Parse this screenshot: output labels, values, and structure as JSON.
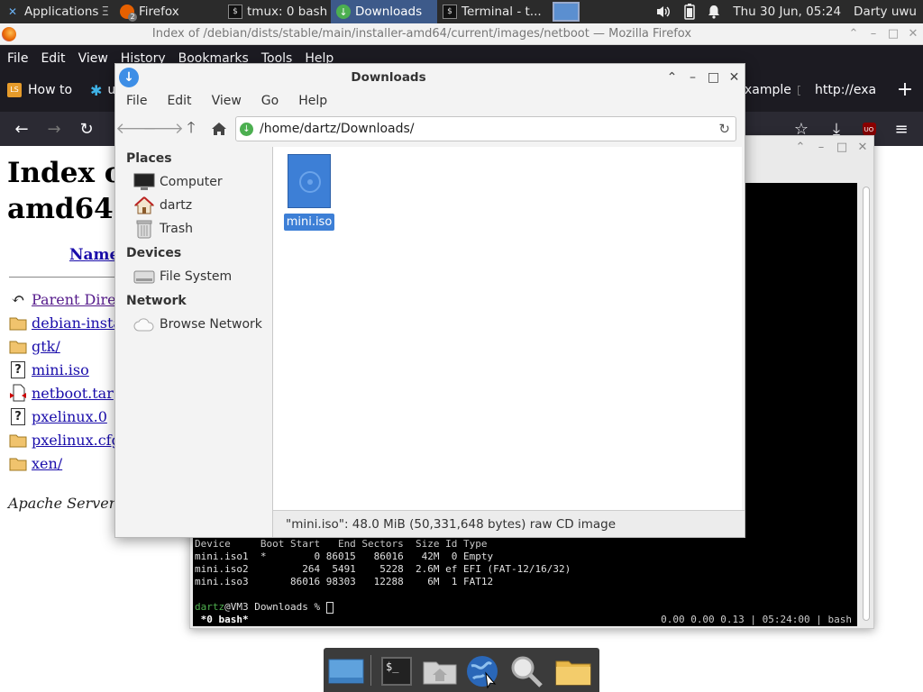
{
  "top_panel": {
    "applications_label": "Applications",
    "items": [
      {
        "label": "Firefox",
        "badge": "2"
      },
      {
        "label": "tmux: 0 bash"
      },
      {
        "label": "Downloads"
      },
      {
        "label": "Terminal - t..."
      }
    ],
    "clock": "Thu 30 Jun, 05:24",
    "user": "Darty uwu",
    "icons": [
      "xfce-icon",
      "firefox-icon",
      "terminal-icon",
      "download-icon",
      "workspace-icon",
      "volume-icon",
      "battery-icon",
      "notification-bell-icon"
    ]
  },
  "firefox": {
    "window_title": "Index of /debian/dists/stable/main/installer-amd64/current/images/netboot — Mozilla Firefox",
    "menu": [
      "File",
      "Edit",
      "View",
      "History",
      "Bookmarks",
      "Tools",
      "Help"
    ],
    "tabs": [
      {
        "label": "How to"
      },
      {
        "label": "u"
      },
      {
        "label": "xample"
      },
      {
        "label": "http://exa"
      }
    ],
    "page": {
      "heading_line1": "Index o",
      "heading_line2": "amd64",
      "name_column": "Name",
      "entries": [
        "Parent Dire",
        "debian-insta",
        "gtk/",
        "mini.iso",
        "netboot.tar",
        "pxelinux.0",
        "pxelinux.cfg",
        "xen/"
      ],
      "footer": "Apache Server"
    }
  },
  "file_manager": {
    "title": "Downloads",
    "menu": [
      "File",
      "Edit",
      "View",
      "Go",
      "Help"
    ],
    "location": "/home/dartz/Downloads/",
    "sidebar": {
      "places_heading": "Places",
      "places": [
        "Computer",
        "dartz",
        "Trash"
      ],
      "devices_heading": "Devices",
      "devices": [
        "File System"
      ],
      "network_heading": "Network",
      "network": [
        "Browse Network"
      ]
    },
    "files": [
      {
        "name": "mini.iso",
        "selected": true
      }
    ],
    "status": "\"mini.iso\": 48.0 MiB (50,331,648 bytes) raw CD image"
  },
  "terminal": {
    "header": "Device     Boot Start   End Sectors  Size Id Type",
    "rows": [
      "mini.iso1  *        0 86015   86016   42M  0 Empty",
      "mini.iso2         264  5491    5228  2.6M ef EFI (FAT-12/16/32)",
      "mini.iso3       86016 98303   12288    6M  1 FAT12"
    ],
    "prompt_user": "dartz",
    "prompt_rest": "@VM3 Downloads % ",
    "tmux_left": " *0 bash*",
    "tmux_right": "0.00 0.00 0.13 | 05:24:00 | bash"
  },
  "dock": {
    "items": [
      "show-desktop-icon",
      "terminal-icon",
      "home-folder-icon",
      "web-browser-icon",
      "search-icon",
      "folder-icon"
    ]
  },
  "colors": {
    "selection": "#3d7fd6",
    "prompt_green": "#4fb04f",
    "panel": "#2b2b2b"
  }
}
